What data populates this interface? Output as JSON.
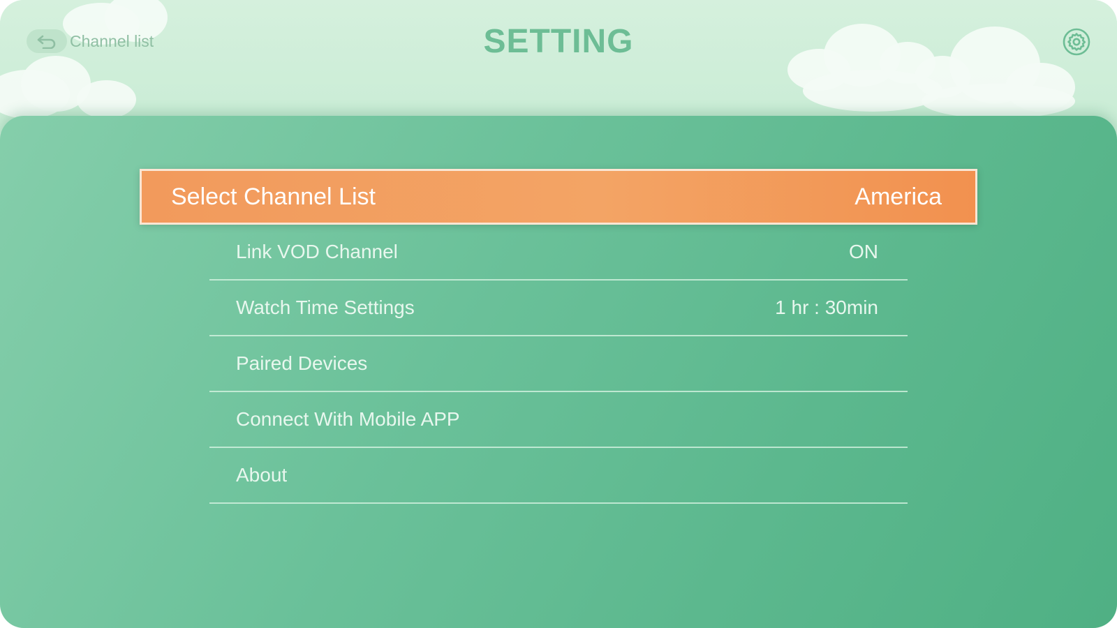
{
  "header": {
    "back_label": "Channel list",
    "title": "SETTING"
  },
  "icons": {
    "back": "back-arrow-icon",
    "settings": "gear-icon"
  },
  "colors": {
    "accent": "#f29a5c",
    "title": "#6dbd95",
    "panel": "#6bc19a"
  },
  "settings": {
    "selected": {
      "label": "Select Channel List",
      "value": "America"
    },
    "items": [
      {
        "label": "Link VOD Channel",
        "value": "ON"
      },
      {
        "label": "Watch Time Settings",
        "value": "1 hr : 30min"
      },
      {
        "label": "Paired Devices",
        "value": ""
      },
      {
        "label": "Connect With Mobile APP",
        "value": ""
      },
      {
        "label": "About",
        "value": ""
      }
    ]
  }
}
